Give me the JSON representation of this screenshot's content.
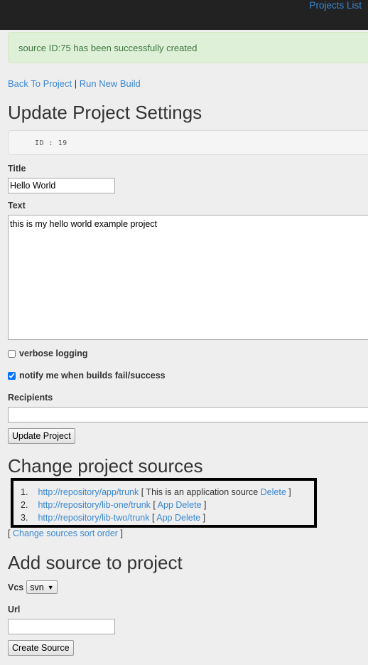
{
  "header": {
    "projects_list": "Projects List"
  },
  "alert": {
    "message": "source ID:75 has been successfully created"
  },
  "nav": {
    "back": "Back To Project",
    "separator": "|",
    "run": "Run New Build"
  },
  "page_title": "Update Project Settings",
  "project_id": "ID : 19",
  "form": {
    "title_label": "Title",
    "title_value": "Hello World",
    "text_label": "Text",
    "text_value": "this is my hello world example project",
    "verbose_label": "verbose logging",
    "verbose_checked": false,
    "notify_label": "notify me when builds fail/success",
    "notify_checked": true,
    "recipients_label": "Recipients",
    "recipients_value": "",
    "update_button": "Update Project"
  },
  "sources_title": "Change project sources",
  "sources": [
    {
      "num": "1.",
      "url": "http://repository/app/trunk",
      "open": "[ This is an application source",
      "action1": "",
      "action2": "Delete",
      "close": "]"
    },
    {
      "num": "2.",
      "url": "http://repository/lib-one/trunk",
      "open": "[",
      "action1": "App",
      "action2": "Delete",
      "close": "]"
    },
    {
      "num": "3.",
      "url": "http://repository/lib-two/trunk",
      "open": "[",
      "action1": "App",
      "action2": "Delete",
      "close": "]"
    }
  ],
  "sort_link": {
    "open": "[",
    "label": "Change sources sort order",
    "close": "]"
  },
  "add_title": "Add source to project",
  "add_form": {
    "vcs_label": "Vcs",
    "vcs_selected": "svn",
    "url_label": "Url",
    "url_value": "",
    "create_button": "Create Source"
  }
}
